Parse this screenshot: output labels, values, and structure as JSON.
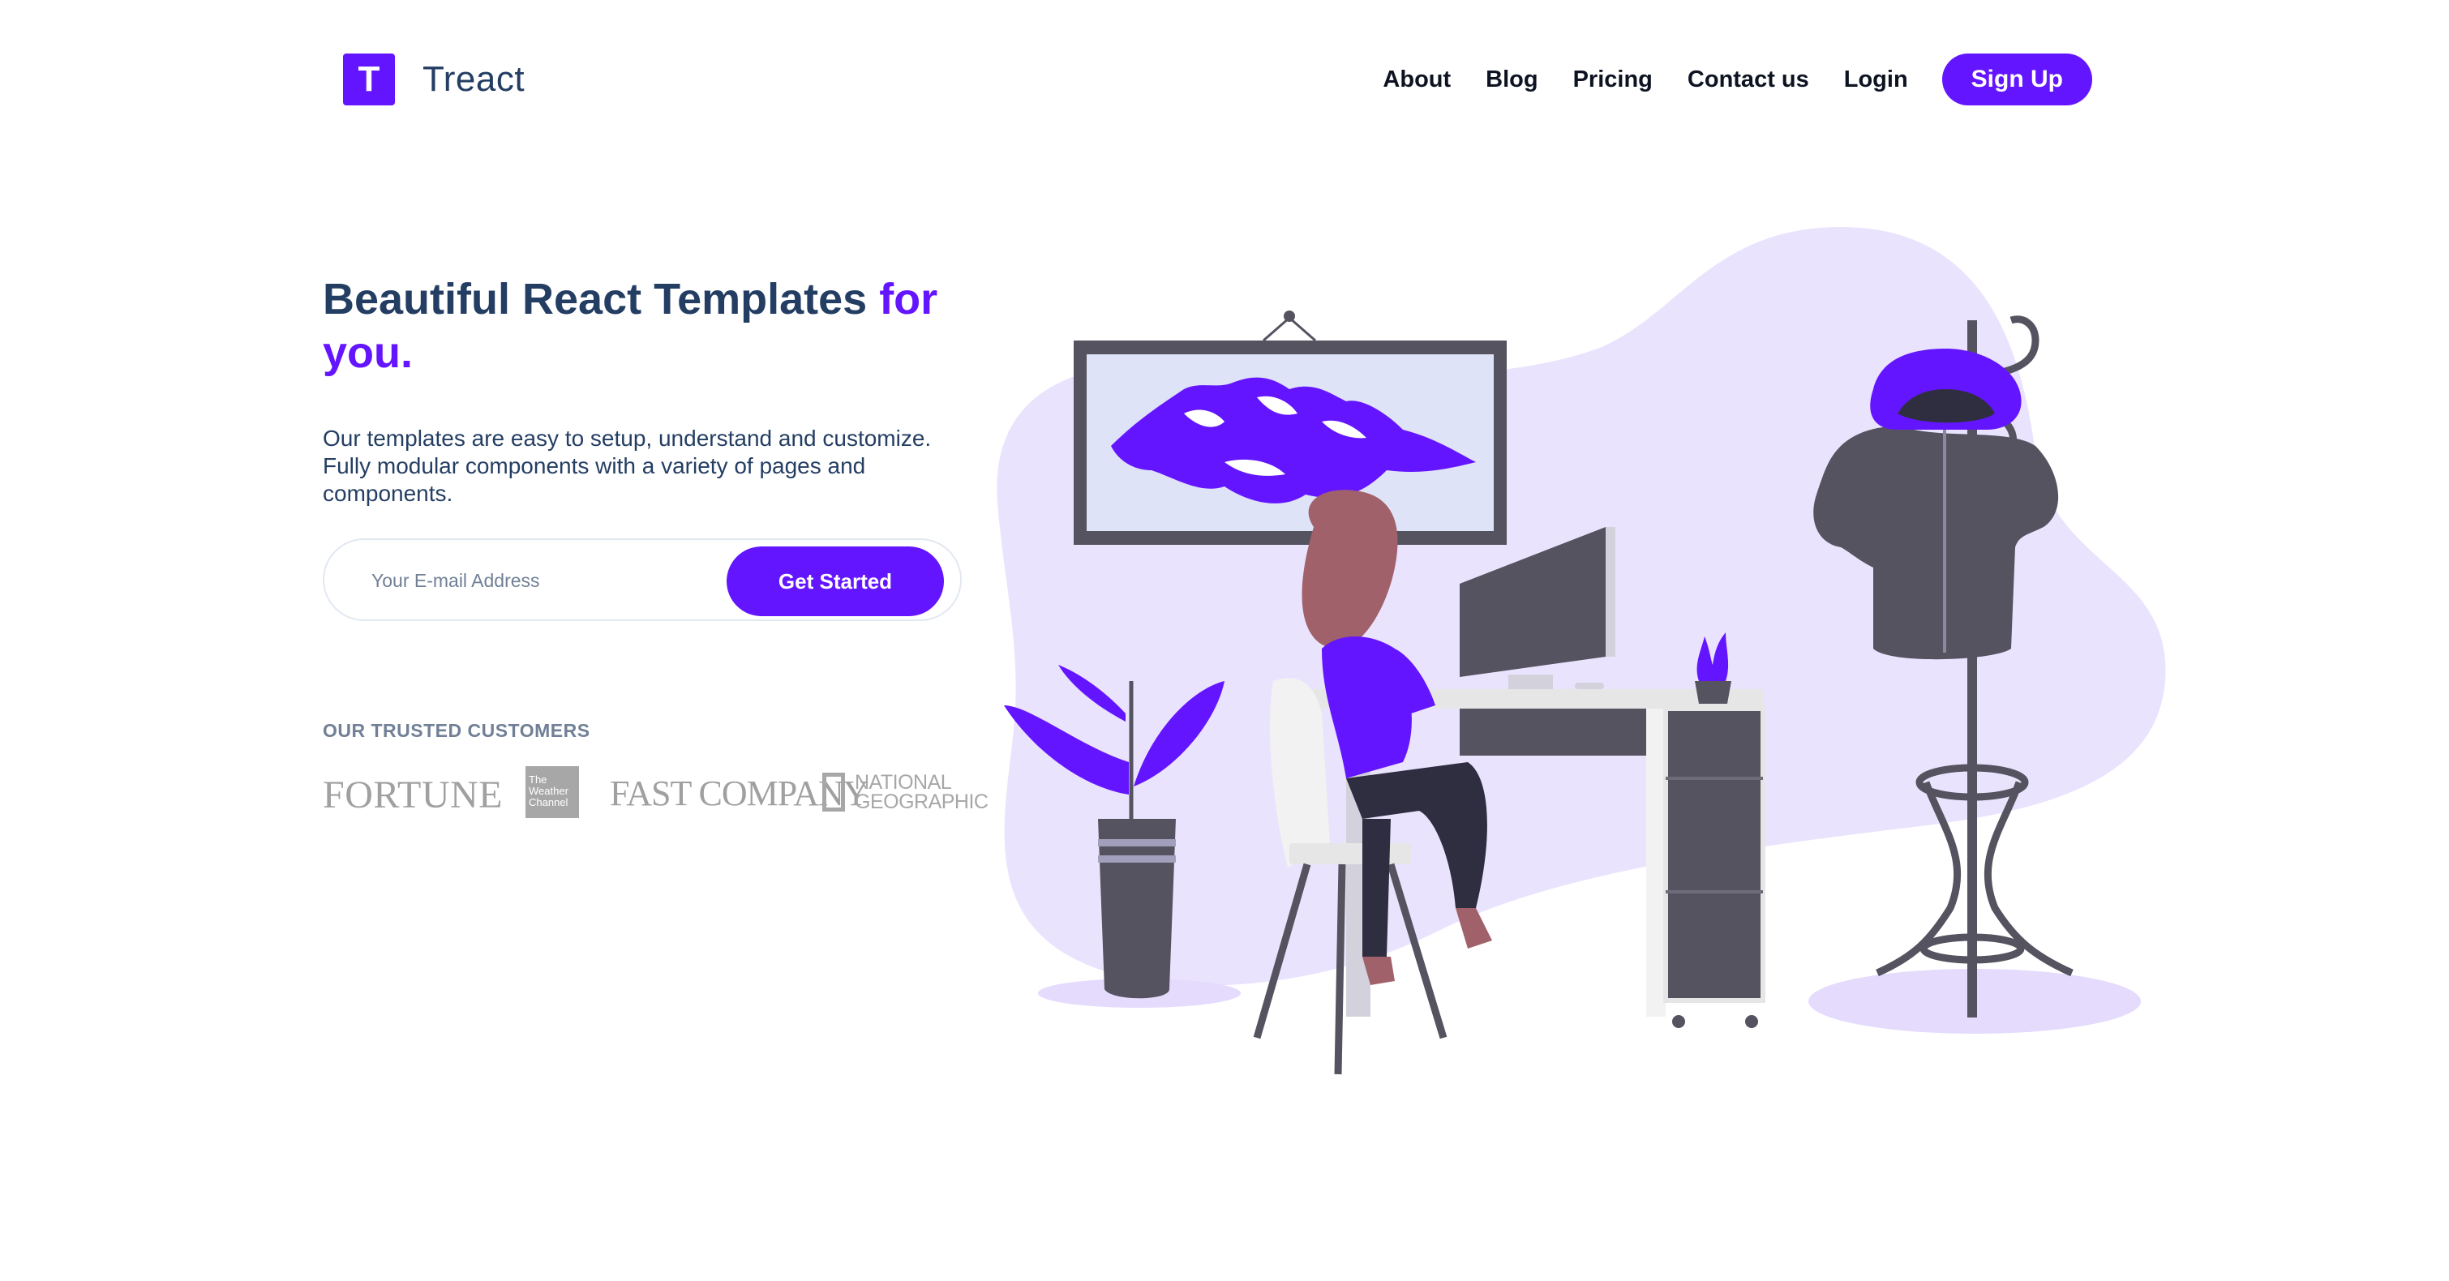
{
  "brand": {
    "logo_letter": "T",
    "name": "Treact"
  },
  "nav": {
    "links": [
      "About",
      "Blog",
      "Pricing",
      "Contact us",
      "Login"
    ],
    "cta": "Sign Up"
  },
  "hero": {
    "heading_main": "Beautiful React Templates ",
    "heading_accent": "for you.",
    "description": "Our templates are easy to setup, understand and customize. Fully modular components with a variety of pages and components.",
    "email_placeholder": "Your E-mail Address",
    "button": "Get Started"
  },
  "customers": {
    "label": "OUR TRUSTED CUSTOMERS",
    "logos": {
      "fortune": "FORTUNE",
      "weather": "The Weather Channel",
      "fastcompany": "FAST COMPANY",
      "natgeo": "NATIONAL GEOGRAPHIC"
    }
  },
  "colors": {
    "primary": "#6415ff",
    "heading": "#243e63",
    "muted": "#718096",
    "illustration_bg": "#eae3fd",
    "illustration_dark": "#54535f"
  }
}
